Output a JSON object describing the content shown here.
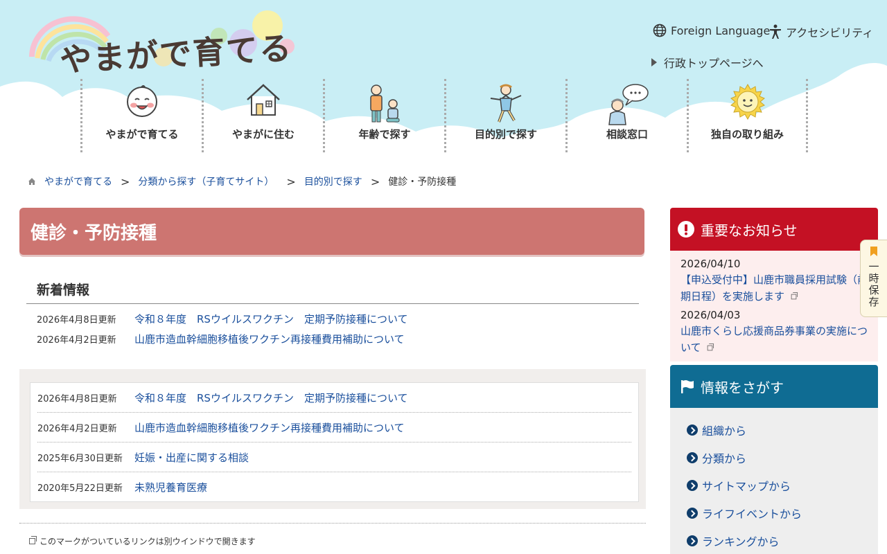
{
  "header": {
    "logo_text": "やまがで育てる",
    "foreign_language": "Foreign Language",
    "accessibility": "アクセシビリティ",
    "gov_top": "行政トップページへ"
  },
  "gnav": [
    {
      "label": "やまがで育てる",
      "icon": "baby-face-icon"
    },
    {
      "label": "やまがに住む",
      "icon": "house-icon"
    },
    {
      "label": "年齢で探す",
      "icon": "family-icon"
    },
    {
      "label": "目的別で探す",
      "icon": "running-child-icon"
    },
    {
      "label": "相談窓口",
      "icon": "consultation-icon"
    },
    {
      "label": "独自の取り組み",
      "icon": "sun-icon"
    }
  ],
  "breadcrumb": {
    "home": "やまがで育てる",
    "level1": "分類から探す（子育てサイト）",
    "level2": "目的別で探す",
    "current": "健診・予防接種",
    "sep": ">"
  },
  "page_title": "健診・予防接種",
  "news": {
    "heading": "新着情報",
    "items": [
      {
        "date": "2026年4月8日更新",
        "title": "令和８年度　RSウイルスワクチン　定期予防接種について"
      },
      {
        "date": "2026年4月2日更新",
        "title": "山鹿市造血幹細胞移植後ワクチン再接種費用補助について"
      }
    ]
  },
  "list": {
    "items": [
      {
        "date": "2026年4月8日更新",
        "title": "令和８年度　RSウイルスワクチン　定期予防接種について"
      },
      {
        "date": "2026年4月2日更新",
        "title": "山鹿市造血幹細胞移植後ワクチン再接種費用補助について"
      },
      {
        "date": "2025年6月30日更新",
        "title": "妊娠・出産に関する相談"
      },
      {
        "date": "2020年5月22日更新",
        "title": "未熟児養育医療"
      }
    ]
  },
  "window_note": "このマークがついているリンクは別ウインドウで開きます",
  "notice": {
    "heading": "重要なお知らせ",
    "items": [
      {
        "date": "2026/04/10",
        "title": "【申込受付中】山鹿市職員採用試験（前期日程）を実施します"
      },
      {
        "date": "2026/04/03",
        "title": "山鹿市くらし応援商品券事業の実施について"
      }
    ]
  },
  "search": {
    "heading": "情報をさがす",
    "items": [
      "組織から",
      "分類から",
      "サイトマップから",
      "ライフイベントから",
      "ランキングから"
    ]
  },
  "temp_save": "一時保存",
  "colors": {
    "sky": "#c9eef5",
    "title_bg": "#cd7571",
    "notice_red": "#c41124",
    "search_blue": "#0f6c93",
    "link": "#1a4f9c"
  }
}
